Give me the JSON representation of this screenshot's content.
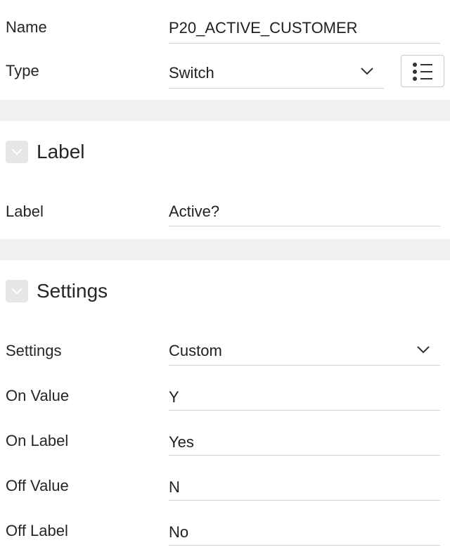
{
  "identification": {
    "name_label": "Name",
    "name_value": "P20_ACTIVE_CUSTOMER",
    "type_label": "Type",
    "type_value": "Switch"
  },
  "sections": {
    "label": {
      "title": "Label",
      "label_field_label": "Label",
      "label_field_value": "Active?"
    },
    "settings": {
      "title": "Settings",
      "settings_label": "Settings",
      "settings_value": "Custom",
      "on_value_label": "On Value",
      "on_value_value": "Y",
      "on_label_label": "On Label",
      "on_label_value": "Yes",
      "off_value_label": "Off Value",
      "off_value_value": "N",
      "off_label_label": "Off Label",
      "off_label_value": "No"
    }
  },
  "icons": {
    "type_select": "chevron-down-icon",
    "list_button": "list-icon",
    "section_toggle": "chevron-down-icon"
  },
  "colors": {
    "band": "#f0f0f0",
    "toggle_bg": "#e6e6e6",
    "underline": "#d4d4d4",
    "text": "#262626"
  }
}
